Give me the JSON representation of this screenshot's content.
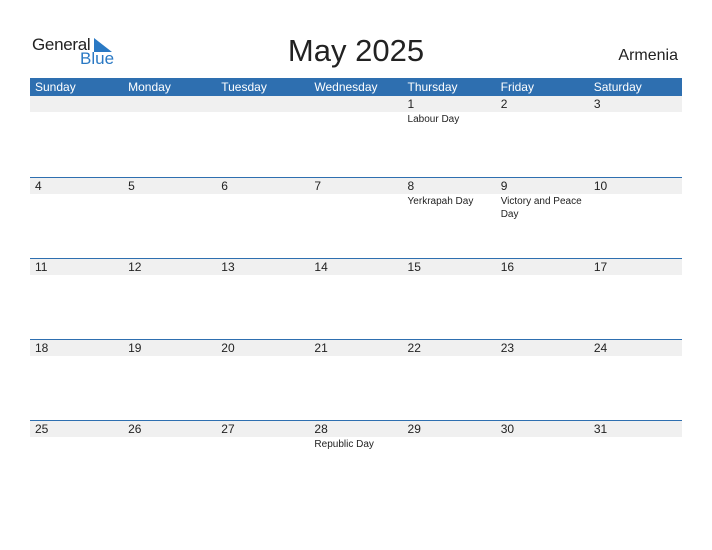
{
  "logo": {
    "general": "General",
    "blue": "Blue"
  },
  "title": "May 2025",
  "country": "Armenia",
  "colors": {
    "header": "#2e6fb0",
    "strip": "#f0f0f0",
    "brand_blue": "#2a79c4"
  },
  "weekdays": [
    "Sunday",
    "Monday",
    "Tuesday",
    "Wednesday",
    "Thursday",
    "Friday",
    "Saturday"
  ],
  "weeks": [
    [
      {
        "day": ""
      },
      {
        "day": ""
      },
      {
        "day": ""
      },
      {
        "day": ""
      },
      {
        "day": "1",
        "holiday": "Labour Day"
      },
      {
        "day": "2"
      },
      {
        "day": "3"
      }
    ],
    [
      {
        "day": "4"
      },
      {
        "day": "5"
      },
      {
        "day": "6"
      },
      {
        "day": "7"
      },
      {
        "day": "8",
        "holiday": "Yerkrapah Day"
      },
      {
        "day": "9",
        "holiday": "Victory and Peace Day"
      },
      {
        "day": "10"
      }
    ],
    [
      {
        "day": "11"
      },
      {
        "day": "12"
      },
      {
        "day": "13"
      },
      {
        "day": "14"
      },
      {
        "day": "15"
      },
      {
        "day": "16"
      },
      {
        "day": "17"
      }
    ],
    [
      {
        "day": "18"
      },
      {
        "day": "19"
      },
      {
        "day": "20"
      },
      {
        "day": "21"
      },
      {
        "day": "22"
      },
      {
        "day": "23"
      },
      {
        "day": "24"
      }
    ],
    [
      {
        "day": "25"
      },
      {
        "day": "26"
      },
      {
        "day": "27"
      },
      {
        "day": "28",
        "holiday": "Republic Day"
      },
      {
        "day": "29"
      },
      {
        "day": "30"
      },
      {
        "day": "31"
      }
    ]
  ]
}
